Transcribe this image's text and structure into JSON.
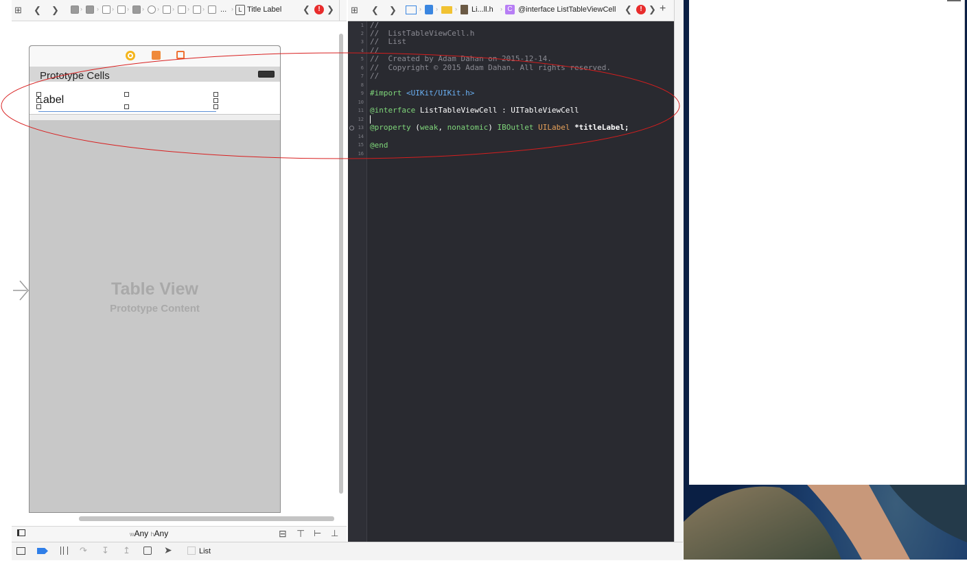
{
  "ib_toolbar": {
    "breadcrumb_end": "...",
    "selection_badge": "L",
    "selection_label": "Title Label",
    "error_glyph": "!"
  },
  "scene": {
    "section_header": "Prototype Cells",
    "cell_label": "Label",
    "placeholder_title": "Table View",
    "placeholder_subtitle": "Prototype Content"
  },
  "size_class": {
    "w_prefix": "w",
    "w_value": "Any",
    "h_prefix": "h",
    "h_value": "Any"
  },
  "debug_bar": {
    "target_label": "List"
  },
  "editor_toolbar": {
    "file_name": "Li...ll.h",
    "class_badge": "C",
    "symbol_label": "@interface ListTableViewCell",
    "error_glyph": "!"
  },
  "code": {
    "line_numbers": [
      "1",
      "2",
      "3",
      "4",
      "5",
      "6",
      "7",
      "8",
      "9",
      "10",
      "11",
      "12",
      "13",
      "14",
      "15",
      "16"
    ],
    "l1": "//",
    "l2": "//  ListTableViewCell.h",
    "l3": "//  List",
    "l4": "//",
    "l5": "//  Created by Adam Dahan on 2015-12-14.",
    "l6": "//  Copyright © 2015 Adam Dahan. All rights reserved.",
    "l7": "//",
    "l9_kw": "#import",
    "l9_path": "<UIKit/UIKit.h>",
    "l11_kw": "@interface",
    "l11_rest": "ListTableViewCell : UITableViewCell",
    "l13_kw": "@property",
    "l13_open": "(",
    "l13_attr1": "weak",
    "l13_comma": ", ",
    "l13_attr2": "nonatomic",
    "l13_close": ")",
    "l13_outlet": "IBOutlet",
    "l13_type": "UILabel",
    "l13_name": "*titleLabel;",
    "l15_kw": "@end"
  },
  "colors": {
    "comment": "#8b8b93",
    "keyword": "#7fd67a",
    "string": "#6ab0f3",
    "type": "#e8a25a",
    "plain": "#ffffff",
    "annotation": "#d81e1e"
  }
}
